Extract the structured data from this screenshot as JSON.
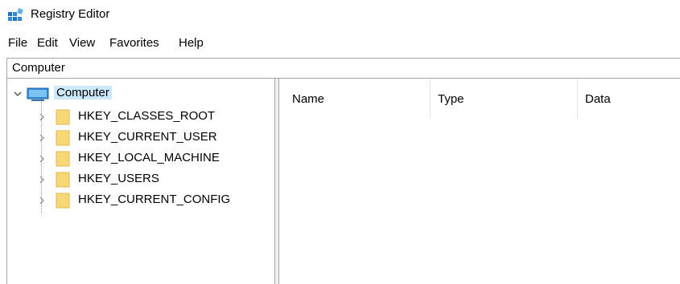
{
  "window": {
    "title": "Registry Editor",
    "icon": "registry-editor-icon"
  },
  "menu": {
    "items": [
      "File",
      "Edit",
      "View",
      "Favorites",
      "Help"
    ]
  },
  "address": {
    "value": "Computer"
  },
  "tree": {
    "root": {
      "label": "Computer",
      "icon": "computer-icon",
      "expanded": true,
      "selected": true
    },
    "children": [
      {
        "label": "HKEY_CLASSES_ROOT",
        "icon": "folder-icon"
      },
      {
        "label": "HKEY_CURRENT_USER",
        "icon": "folder-icon"
      },
      {
        "label": "HKEY_LOCAL_MACHINE",
        "icon": "folder-icon"
      },
      {
        "label": "HKEY_USERS",
        "icon": "folder-icon"
      },
      {
        "label": "HKEY_CURRENT_CONFIG",
        "icon": "folder-icon"
      }
    ]
  },
  "list": {
    "columns": [
      "Name",
      "Type",
      "Data"
    ]
  },
  "colors": {
    "selection": "#cce8ff",
    "folder": "#f8d775",
    "border": "#a6a6a6"
  }
}
